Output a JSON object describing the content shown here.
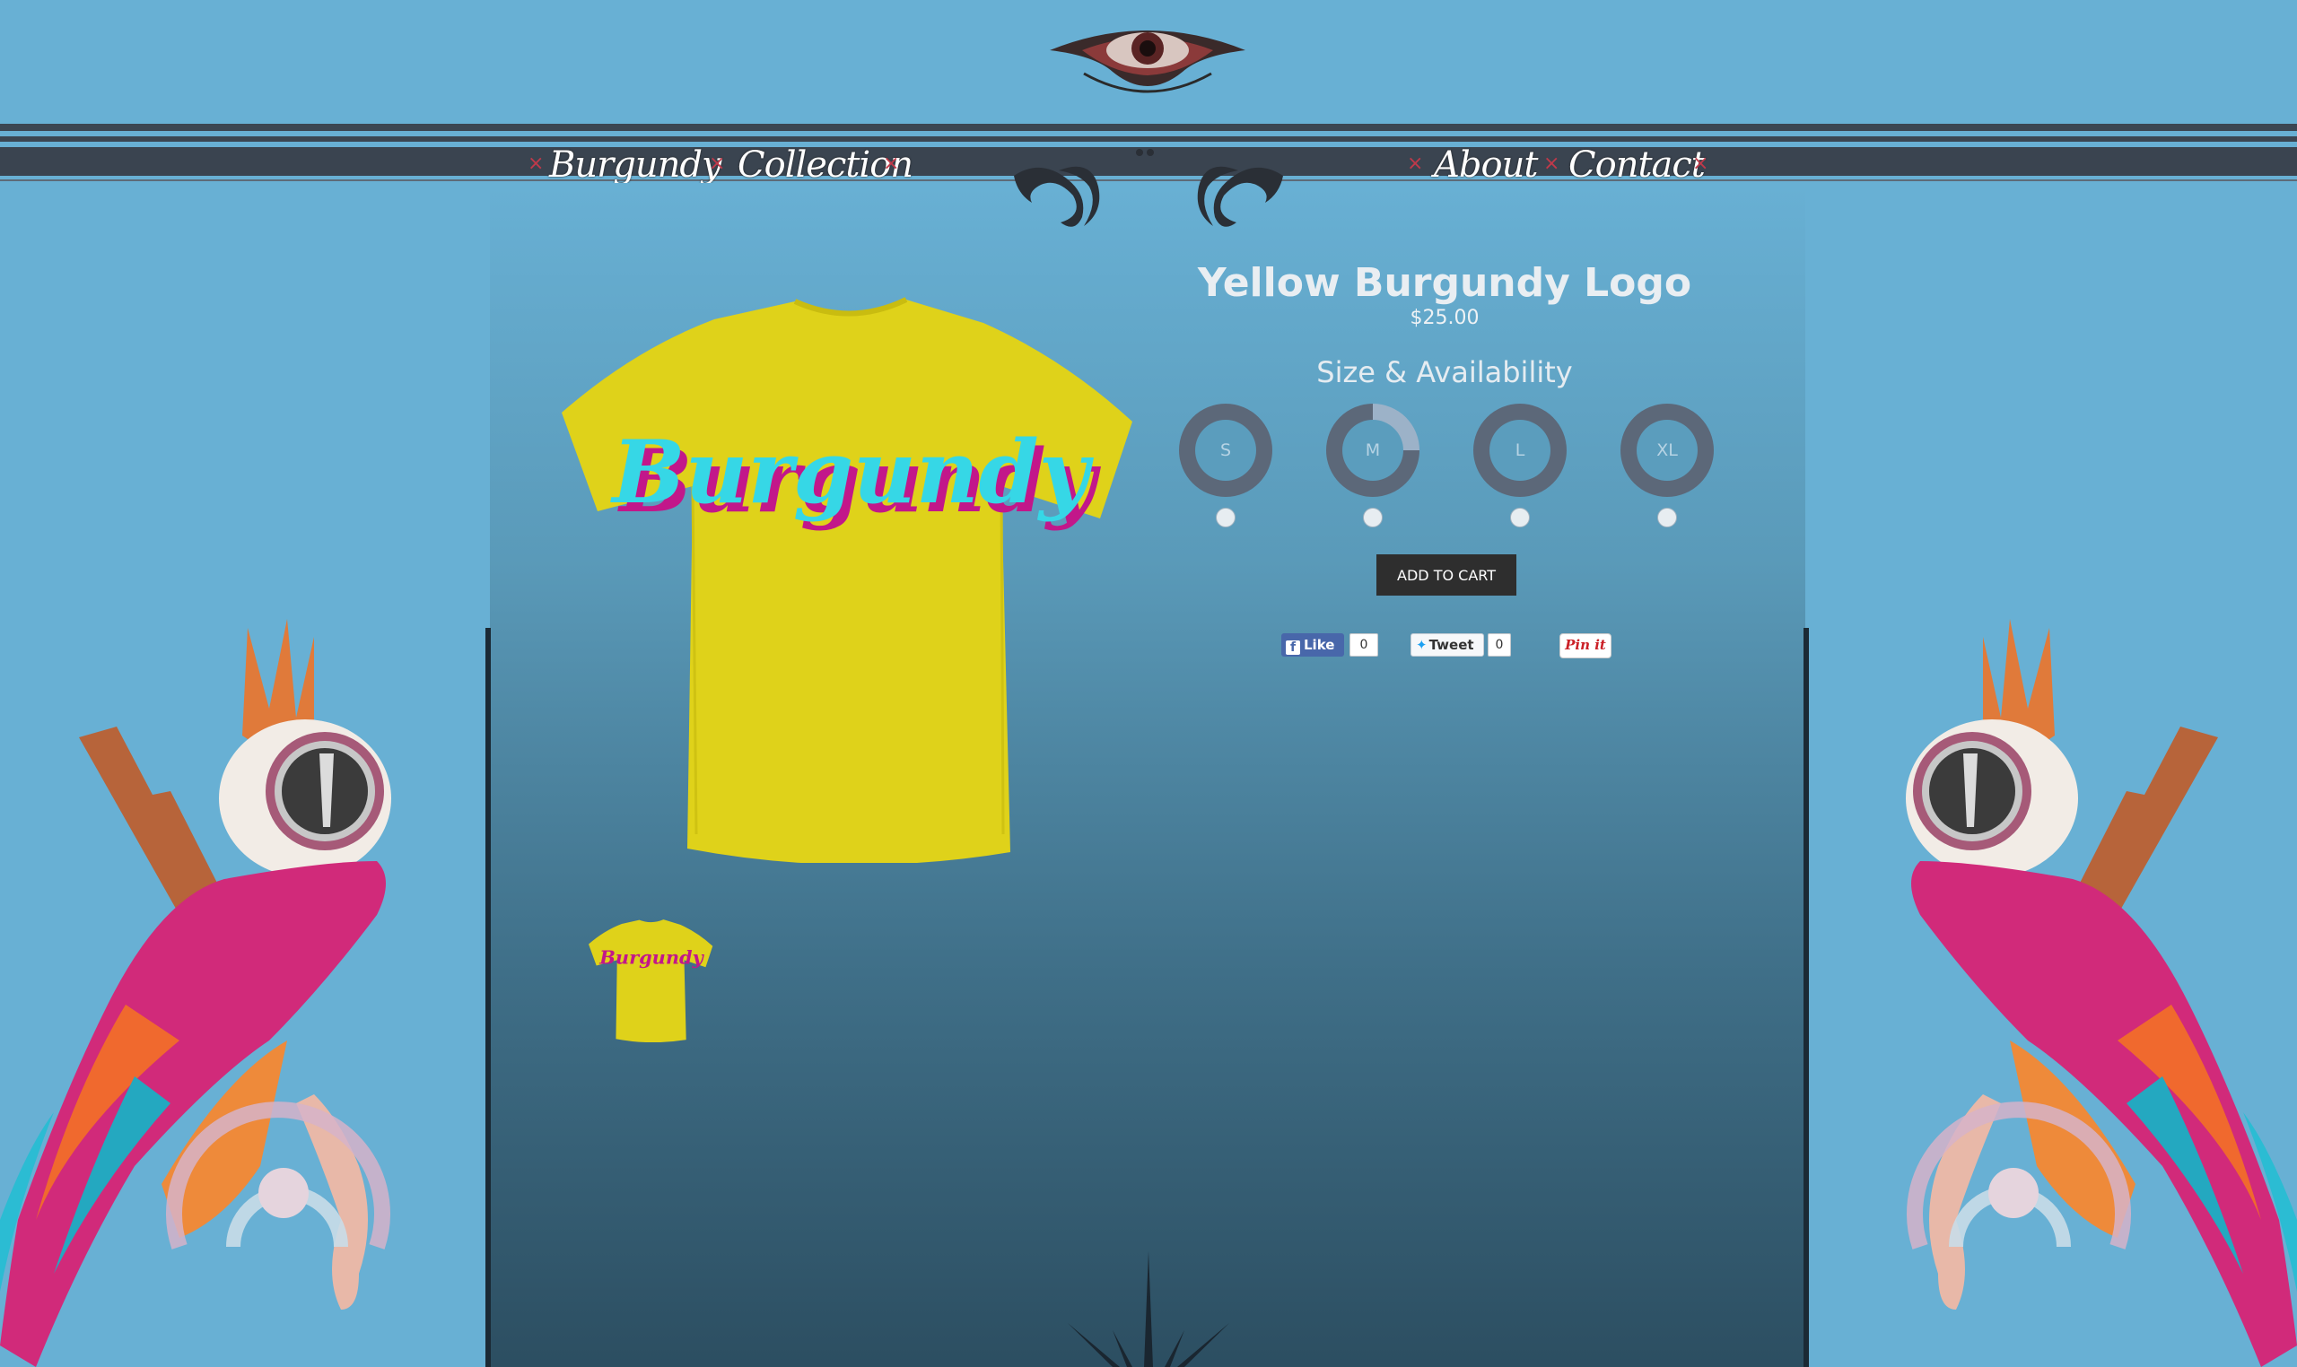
{
  "nav": {
    "left": [
      "Burgundy",
      "Collection"
    ],
    "right": [
      "About",
      "Contact"
    ],
    "separator": "×"
  },
  "product": {
    "title": "Yellow Burgundy Logo",
    "price": "$25.00",
    "shirt_color": "#dfd21a",
    "logo_text": "Burgundy"
  },
  "sizes": {
    "heading": "Size & Availability",
    "options": [
      {
        "label": "S",
        "availability": 0
      },
      {
        "label": "M",
        "availability": 0.25
      },
      {
        "label": "L",
        "availability": 0
      },
      {
        "label": "XL",
        "availability": 0
      }
    ]
  },
  "cart": {
    "add_label": "ADD TO CART"
  },
  "social": {
    "facebook": {
      "label": "Like",
      "count": "0"
    },
    "twitter": {
      "label": "Tweet",
      "count": "0"
    },
    "pinterest": {
      "label": "Pin it"
    }
  },
  "colors": {
    "background": "#68b0d4",
    "nav_band": "#3b4652",
    "button": "#2e2e2e"
  }
}
